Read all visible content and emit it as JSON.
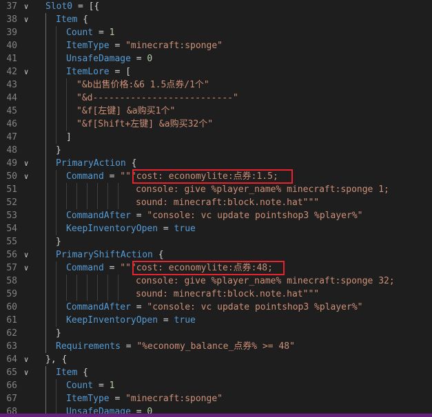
{
  "editor": {
    "lines": [
      {
        "num": "37",
        "fold": "open",
        "indent": 0,
        "tokens": [
          {
            "t": "Slot0",
            "c": "k"
          },
          {
            "t": " = [{",
            "c": "p"
          }
        ]
      },
      {
        "num": "38",
        "fold": "open",
        "indent": 1,
        "tokens": [
          {
            "t": "Item",
            "c": "k"
          },
          {
            "t": " {",
            "c": "p"
          }
        ]
      },
      {
        "num": "39",
        "fold": "",
        "indent": 2,
        "tokens": [
          {
            "t": "Count",
            "c": "k"
          },
          {
            "t": " = ",
            "c": "p"
          },
          {
            "t": "1",
            "c": "n"
          }
        ]
      },
      {
        "num": "40",
        "fold": "",
        "indent": 2,
        "tokens": [
          {
            "t": "ItemType",
            "c": "k"
          },
          {
            "t": " = ",
            "c": "p"
          },
          {
            "t": "\"minecraft:sponge\"",
            "c": "s"
          }
        ]
      },
      {
        "num": "41",
        "fold": "",
        "indent": 2,
        "tokens": [
          {
            "t": "UnsafeDamage",
            "c": "k"
          },
          {
            "t": " = ",
            "c": "p"
          },
          {
            "t": "0",
            "c": "n"
          }
        ]
      },
      {
        "num": "42",
        "fold": "open",
        "indent": 2,
        "tokens": [
          {
            "t": "ItemLore",
            "c": "k"
          },
          {
            "t": " = [",
            "c": "p"
          }
        ]
      },
      {
        "num": "43",
        "fold": "",
        "indent": 3,
        "tokens": [
          {
            "t": "\"&b出售价格:&6 1.5点券/1个\"",
            "c": "s"
          }
        ]
      },
      {
        "num": "44",
        "fold": "",
        "indent": 3,
        "tokens": [
          {
            "t": "\"&d--------------------------\"",
            "c": "s"
          }
        ]
      },
      {
        "num": "45",
        "fold": "",
        "indent": 3,
        "tokens": [
          {
            "t": "\"&f[左键] &a购买1个\"",
            "c": "s"
          }
        ]
      },
      {
        "num": "46",
        "fold": "",
        "indent": 3,
        "tokens": [
          {
            "t": "\"&f[Shift+左键] &a购买32个\"",
            "c": "s"
          }
        ]
      },
      {
        "num": "47",
        "fold": "",
        "indent": 2,
        "tokens": [
          {
            "t": "]",
            "c": "p"
          }
        ]
      },
      {
        "num": "48",
        "fold": "",
        "indent": 1,
        "tokens": [
          {
            "t": "}",
            "c": "p"
          }
        ]
      },
      {
        "num": "49",
        "fold": "open",
        "indent": 1,
        "tokens": [
          {
            "t": "PrimaryAction",
            "c": "k"
          },
          {
            "t": " {",
            "c": "p"
          }
        ]
      },
      {
        "num": "50",
        "fold": "open",
        "indent": 2,
        "tokens": [
          {
            "t": "Command",
            "c": "k"
          },
          {
            "t": " = ",
            "c": "p"
          },
          {
            "t": "\"\"\"cost: economylite:点券:1.5;",
            "c": "s"
          }
        ]
      },
      {
        "num": "51",
        "fold": "",
        "indent": 2,
        "cont": true,
        "tokens": [
          {
            "t": "console: give %player_name% minecraft:sponge 1;",
            "c": "s"
          }
        ]
      },
      {
        "num": "52",
        "fold": "",
        "indent": 2,
        "cont": true,
        "tokens": [
          {
            "t": "sound: minecraft:block.note.hat\"\"\"",
            "c": "s"
          }
        ]
      },
      {
        "num": "53",
        "fold": "",
        "indent": 2,
        "tokens": [
          {
            "t": "CommandAfter",
            "c": "k"
          },
          {
            "t": " = ",
            "c": "p"
          },
          {
            "t": "\"console: vc update pointshop3 %player%\"",
            "c": "s"
          }
        ]
      },
      {
        "num": "54",
        "fold": "",
        "indent": 2,
        "tokens": [
          {
            "t": "KeepInventoryOpen",
            "c": "k"
          },
          {
            "t": " = ",
            "c": "p"
          },
          {
            "t": "true",
            "c": "k"
          }
        ]
      },
      {
        "num": "55",
        "fold": "",
        "indent": 1,
        "tokens": [
          {
            "t": "}",
            "c": "p"
          }
        ]
      },
      {
        "num": "56",
        "fold": "open",
        "indent": 1,
        "tokens": [
          {
            "t": "PrimaryShiftAction",
            "c": "k"
          },
          {
            "t": " {",
            "c": "p"
          }
        ]
      },
      {
        "num": "57",
        "fold": "open",
        "indent": 2,
        "tokens": [
          {
            "t": "Command",
            "c": "k"
          },
          {
            "t": " = ",
            "c": "p"
          },
          {
            "t": "\"\"\"cost: economylite:点券:48;",
            "c": "s"
          }
        ]
      },
      {
        "num": "58",
        "fold": "",
        "indent": 2,
        "cont": true,
        "tokens": [
          {
            "t": "console: give %player_name% minecraft:sponge 32;",
            "c": "s"
          }
        ]
      },
      {
        "num": "59",
        "fold": "",
        "indent": 2,
        "cont": true,
        "tokens": [
          {
            "t": "sound: minecraft:block.note.hat\"\"\"",
            "c": "s"
          }
        ]
      },
      {
        "num": "60",
        "fold": "",
        "indent": 2,
        "tokens": [
          {
            "t": "CommandAfter",
            "c": "k"
          },
          {
            "t": " = ",
            "c": "p"
          },
          {
            "t": "\"console: vc update pointshop3 %player%\"",
            "c": "s"
          }
        ]
      },
      {
        "num": "61",
        "fold": "",
        "indent": 2,
        "tokens": [
          {
            "t": "KeepInventoryOpen",
            "c": "k"
          },
          {
            "t": " = ",
            "c": "p"
          },
          {
            "t": "true",
            "c": "k"
          }
        ]
      },
      {
        "num": "62",
        "fold": "",
        "indent": 1,
        "tokens": [
          {
            "t": "}",
            "c": "p"
          }
        ]
      },
      {
        "num": "63",
        "fold": "",
        "indent": 1,
        "tokens": [
          {
            "t": "Requirements",
            "c": "k"
          },
          {
            "t": " = ",
            "c": "p"
          },
          {
            "t": "\"%economy_balance_点券% >= 48\"",
            "c": "s"
          }
        ]
      },
      {
        "num": "64",
        "fold": "open",
        "indent": 0,
        "tokens": [
          {
            "t": "}, {",
            "c": "p"
          }
        ]
      },
      {
        "num": "65",
        "fold": "open",
        "indent": 1,
        "tokens": [
          {
            "t": "Item",
            "c": "k"
          },
          {
            "t": " {",
            "c": "p"
          }
        ]
      },
      {
        "num": "66",
        "fold": "",
        "indent": 2,
        "tokens": [
          {
            "t": "Count",
            "c": "k"
          },
          {
            "t": " = ",
            "c": "p"
          },
          {
            "t": "1",
            "c": "n"
          }
        ]
      },
      {
        "num": "67",
        "fold": "",
        "indent": 2,
        "tokens": [
          {
            "t": "ItemType",
            "c": "k"
          },
          {
            "t": " = ",
            "c": "p"
          },
          {
            "t": "\"minecraft:sponge\"",
            "c": "s"
          }
        ]
      },
      {
        "num": "68",
        "fold": "",
        "indent": 2,
        "tokens": [
          {
            "t": "UnsafeDamage",
            "c": "k"
          },
          {
            "t": " = ",
            "c": "p"
          },
          {
            "t": "0",
            "c": "n"
          }
        ]
      }
    ],
    "highlights": [
      {
        "line": "50",
        "label": "cost: economylite:点券:1.5;"
      },
      {
        "line": "57",
        "label": "cost: economylite:点券:48;"
      }
    ]
  },
  "colors": {
    "background": "#1e1e1e",
    "keyword": "#569cd6",
    "string": "#ce9178",
    "number": "#b5cea8",
    "highlight_border": "#e8232d",
    "statusbar": "#68217a"
  }
}
